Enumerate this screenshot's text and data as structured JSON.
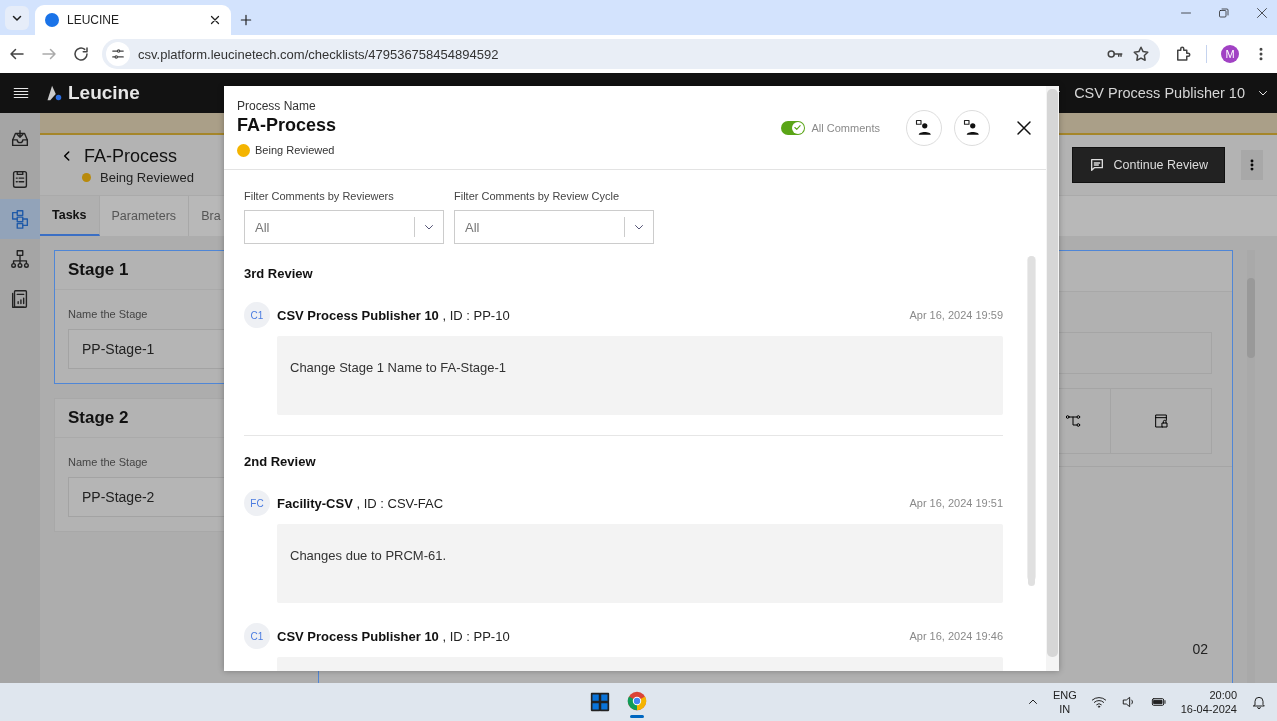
{
  "browser": {
    "tabs": [
      {
        "title": "LEUCINE",
        "selected": true
      }
    ],
    "url": "csv.platform.leucinetech.com/checklists/479536758454894592",
    "profile_initial": "M"
  },
  "app": {
    "logo": "Leucine",
    "user": "CSV Process Publisher 10",
    "rail": [
      {
        "selected": false
      },
      {
        "selected": false
      },
      {
        "selected": true
      },
      {
        "selected": false
      },
      {
        "selected": false
      }
    ],
    "page": {
      "title": "FA-Process",
      "status": {
        "label": "Being Reviewed",
        "color": "#b88a0c"
      },
      "primary_action": "Continue Review",
      "tabs": [
        {
          "label": "Tasks",
          "selected": true
        },
        {
          "label": "Parameters",
          "selected": false
        },
        {
          "label": "Bra",
          "selected": false
        }
      ],
      "stages": [
        {
          "title": "Stage 1",
          "field_label": "Name the Stage",
          "value": "PP-Stage-1",
          "selected": true
        },
        {
          "title": "Stage 2",
          "field_label": "Name the Stage",
          "value": "PP-Stage-2",
          "selected": false
        }
      ],
      "task_number": "02"
    }
  },
  "modal": {
    "label": "Process Name",
    "title": "FA-Process",
    "status": {
      "label": "Being Reviewed",
      "color": "#f4b400"
    },
    "toggle": {
      "label": "All Comments",
      "on": true
    },
    "filters": [
      {
        "label": "Filter Comments by Reviewers",
        "value": "All"
      },
      {
        "label": "Filter Comments by Review Cycle",
        "value": "All"
      }
    ],
    "reviews": [
      {
        "title": "3rd Review",
        "comments": [
          {
            "initials": "C1",
            "author": "**CSV Process Publisher 10** , ID : PP-10",
            "time": "Apr 16, 2024 19:59",
            "body": "Change Stage 1 Name to FA-Stage-1"
          }
        ]
      },
      {
        "title": "2nd Review",
        "comments": [
          {
            "initials": "FC",
            "author": "**Facility-CSV** , ID : CSV-FAC",
            "time": "Apr 16, 2024 19:51",
            "body": "Changes due to PRCM-61."
          },
          {
            "initials": "C1",
            "author": "**CSV Process Publisher 10** , ID : PP-10",
            "time": "Apr 16, 2024 19:46"
          }
        ]
      }
    ]
  },
  "taskbar": {
    "language": "ENG",
    "region": "IN",
    "time": "20:00",
    "date": "16-04-2024"
  }
}
